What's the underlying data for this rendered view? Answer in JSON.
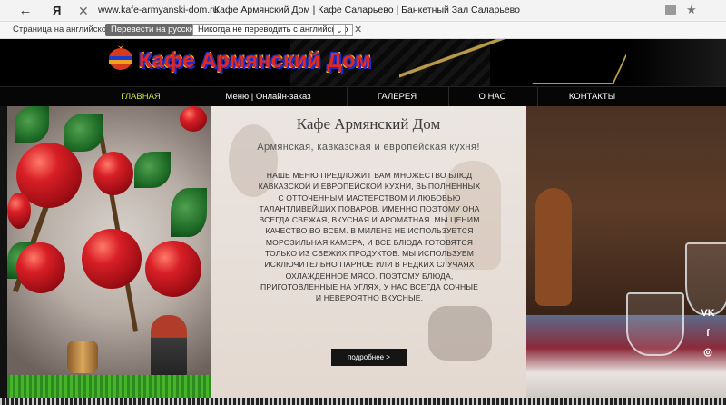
{
  "browser": {
    "back_glyph": "←",
    "logo": "Я",
    "close_glyph": "✕",
    "url": "www.kafe-armyanski-dom.ru",
    "page_title": "Кафе Армянский Дом | Кафе Саларьево | Банкетный Зал Саларьево",
    "bookmark_glyph": "★",
    "icons": [
      "back-arrow-icon",
      "yandex-logo-icon",
      "close-icon",
      "reader-mode-icon",
      "bookmark-star-icon"
    ]
  },
  "translate_bar": {
    "label": "Страница на английском",
    "translate_button": "Перевести на русский",
    "never_button": "Никогда не переводить с английского",
    "dropdown_glyph": "⌄",
    "close_glyph": "✕"
  },
  "header": {
    "logo_text": "Кафе Армянский Дом",
    "logo_colors": {
      "fill": "#e0281e",
      "outline": "#1d2ec8",
      "highlight": "#e8b21c"
    }
  },
  "nav": {
    "items": [
      {
        "label": "ГЛАВНАЯ",
        "active": true
      },
      {
        "label": "Меню | Онлайн-заказ"
      },
      {
        "label": "ГАЛЕРЕЯ"
      },
      {
        "label": "О НАС"
      },
      {
        "label": "КОНТАКТЫ"
      }
    ],
    "active_color": "#c9e24a"
  },
  "hero": {
    "title": "Кафе Армянский Дом",
    "subtitle": "Армянская, кавказская и европейская кухня!",
    "body_lines": [
      "НАШЕ МЕНЮ ПРЕДЛОЖИТ ВАМ МНОЖЕСТВО БЛЮД",
      "КАВКАЗСКОЙ И ЕВРОПЕЙСКОЙ КУХНИ, ВЫПОЛНЕННЫХ",
      "С ОТТОЧЕННЫМ МАСТЕРСТВОМ И ЛЮБОВЬЮ",
      "ТАЛАНТЛИВЕЙШИХ ПОВАРОВ.  ИМЕННО ПОЭТОМУ ОНА",
      "ВСЕГДА СВЕЖАЯ, ВКУСНАЯ И АРОМАТНАЯ.  МЫ ЦЕНИМ",
      "КАЧЕСТВО ВО ВСЕМ.  В МИЛЕНЕ  НЕ ИСПОЛЬЗУЕТСЯ",
      "МОРОЗИЛЬНАЯ КАМЕРА, И ВСЕ БЛЮДА ГОТОВЯТСЯ",
      "ТОЛЬКО ИЗ СВЕЖИХ ПРОДУКТОВ.  МЫ ИСПОЛЬЗУЕМ",
      "ИСКЛЮЧИТЕЛЬНО ПАРНОЕ ИЛИ В РЕДКИХ СЛУЧАЯХ",
      "ОХЛАЖДЕННОЕ МЯСО.  ПОЭТОМУ БЛЮДА,",
      "ПРИГОТОВЛЕННЫЕ НА УГЛЯХ, У НАС ВСЕГДА СОЧНЫЕ",
      "И НЕВЕРОЯТНО ВКУСНЫЕ."
    ],
    "more_button": "подробнее >"
  },
  "social": {
    "vk": "VK",
    "facebook": "f",
    "instagram": "◎",
    "icons": [
      "vk-icon",
      "facebook-icon",
      "instagram-icon"
    ]
  }
}
